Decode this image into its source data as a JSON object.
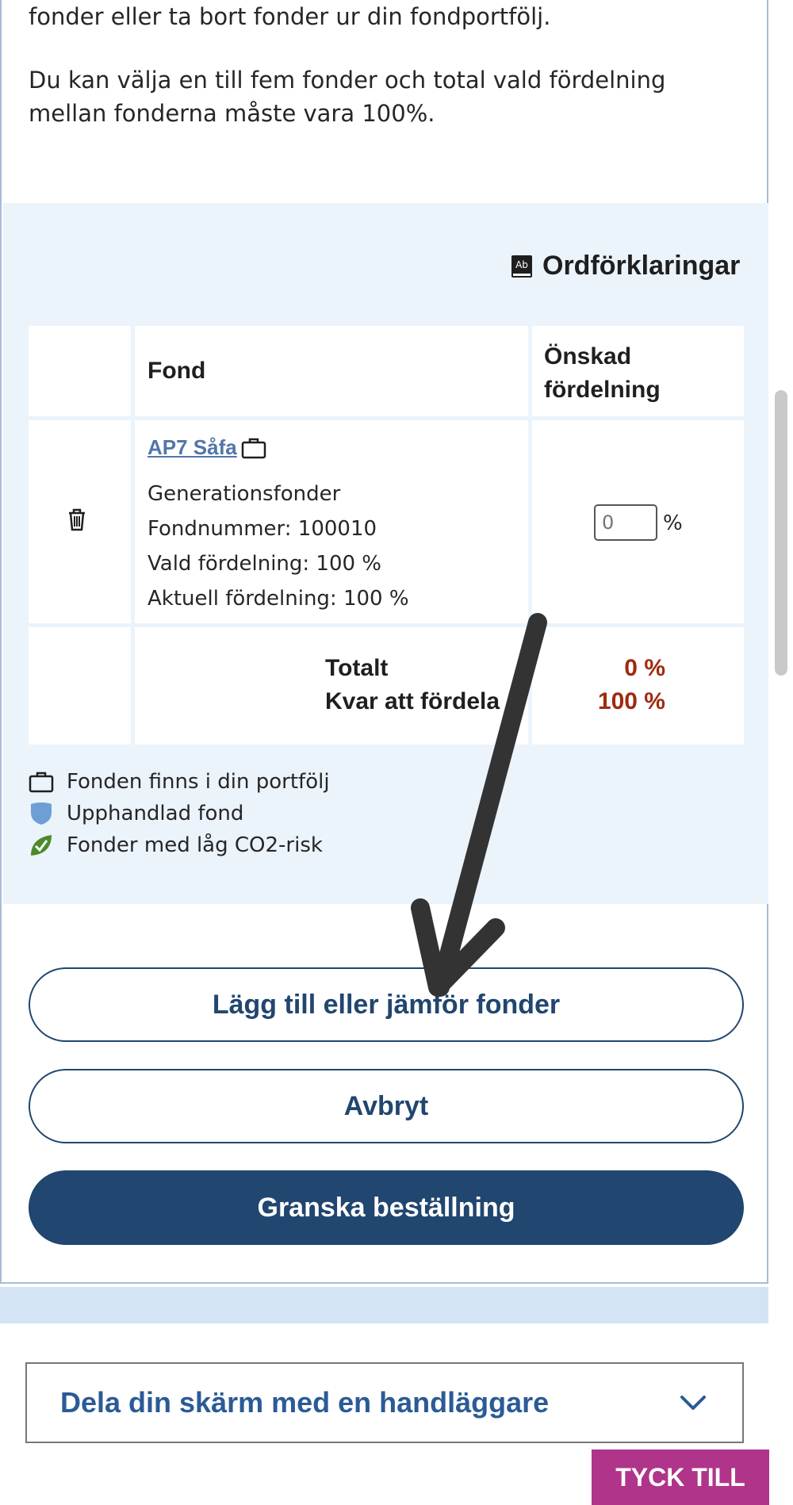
{
  "intro": {
    "line1": "fonder eller ta bort fonder ur din fondportfölj.",
    "line2": "Du kan välja en till fem fonder och total vald fördelning mellan fonderna måste vara 100%."
  },
  "glossary": {
    "label": "Ordförklaringar",
    "icon": "book-ab-icon"
  },
  "table": {
    "headers": {
      "fund": "Fond",
      "desired": "Önskad fördelning"
    },
    "row": {
      "name": "AP7 Såfa",
      "category": "Generationsfonder",
      "fund_number": "Fondnummer: 100010",
      "selected": "Vald fördelning: 100 %",
      "current": "Aktuell fördelning: 100 %",
      "input_placeholder": "0",
      "percent_sign": "%",
      "delete_icon": "trash-icon",
      "portfolio_icon": "briefcase-icon"
    },
    "totals": {
      "total_label": "Totalt",
      "total_value": "0 %",
      "remaining_label": "Kvar att fördela",
      "remaining_value": "100 %"
    }
  },
  "legend": [
    {
      "icon": "briefcase-icon",
      "label": "Fonden finns i din portfölj"
    },
    {
      "icon": "shield-icon",
      "label": "Upphandlad fond"
    },
    {
      "icon": "check-leaf-icon",
      "label": "Fonder med låg CO2-risk"
    }
  ],
  "buttons": {
    "add_compare": "Lägg till eller jämför fonder",
    "cancel": "Avbryt",
    "review": "Granska beställning"
  },
  "accordion": {
    "label": "Dela din skärm med en handläggare",
    "icon": "chevron-down-icon"
  },
  "feedback": {
    "label": "TYCK TILL"
  },
  "colors": {
    "primary": "#21466f",
    "link": "#5276a8",
    "warning_value": "#a02a0f",
    "panel_bg": "#ebf3fb",
    "feedback_bg": "#b0348a"
  }
}
